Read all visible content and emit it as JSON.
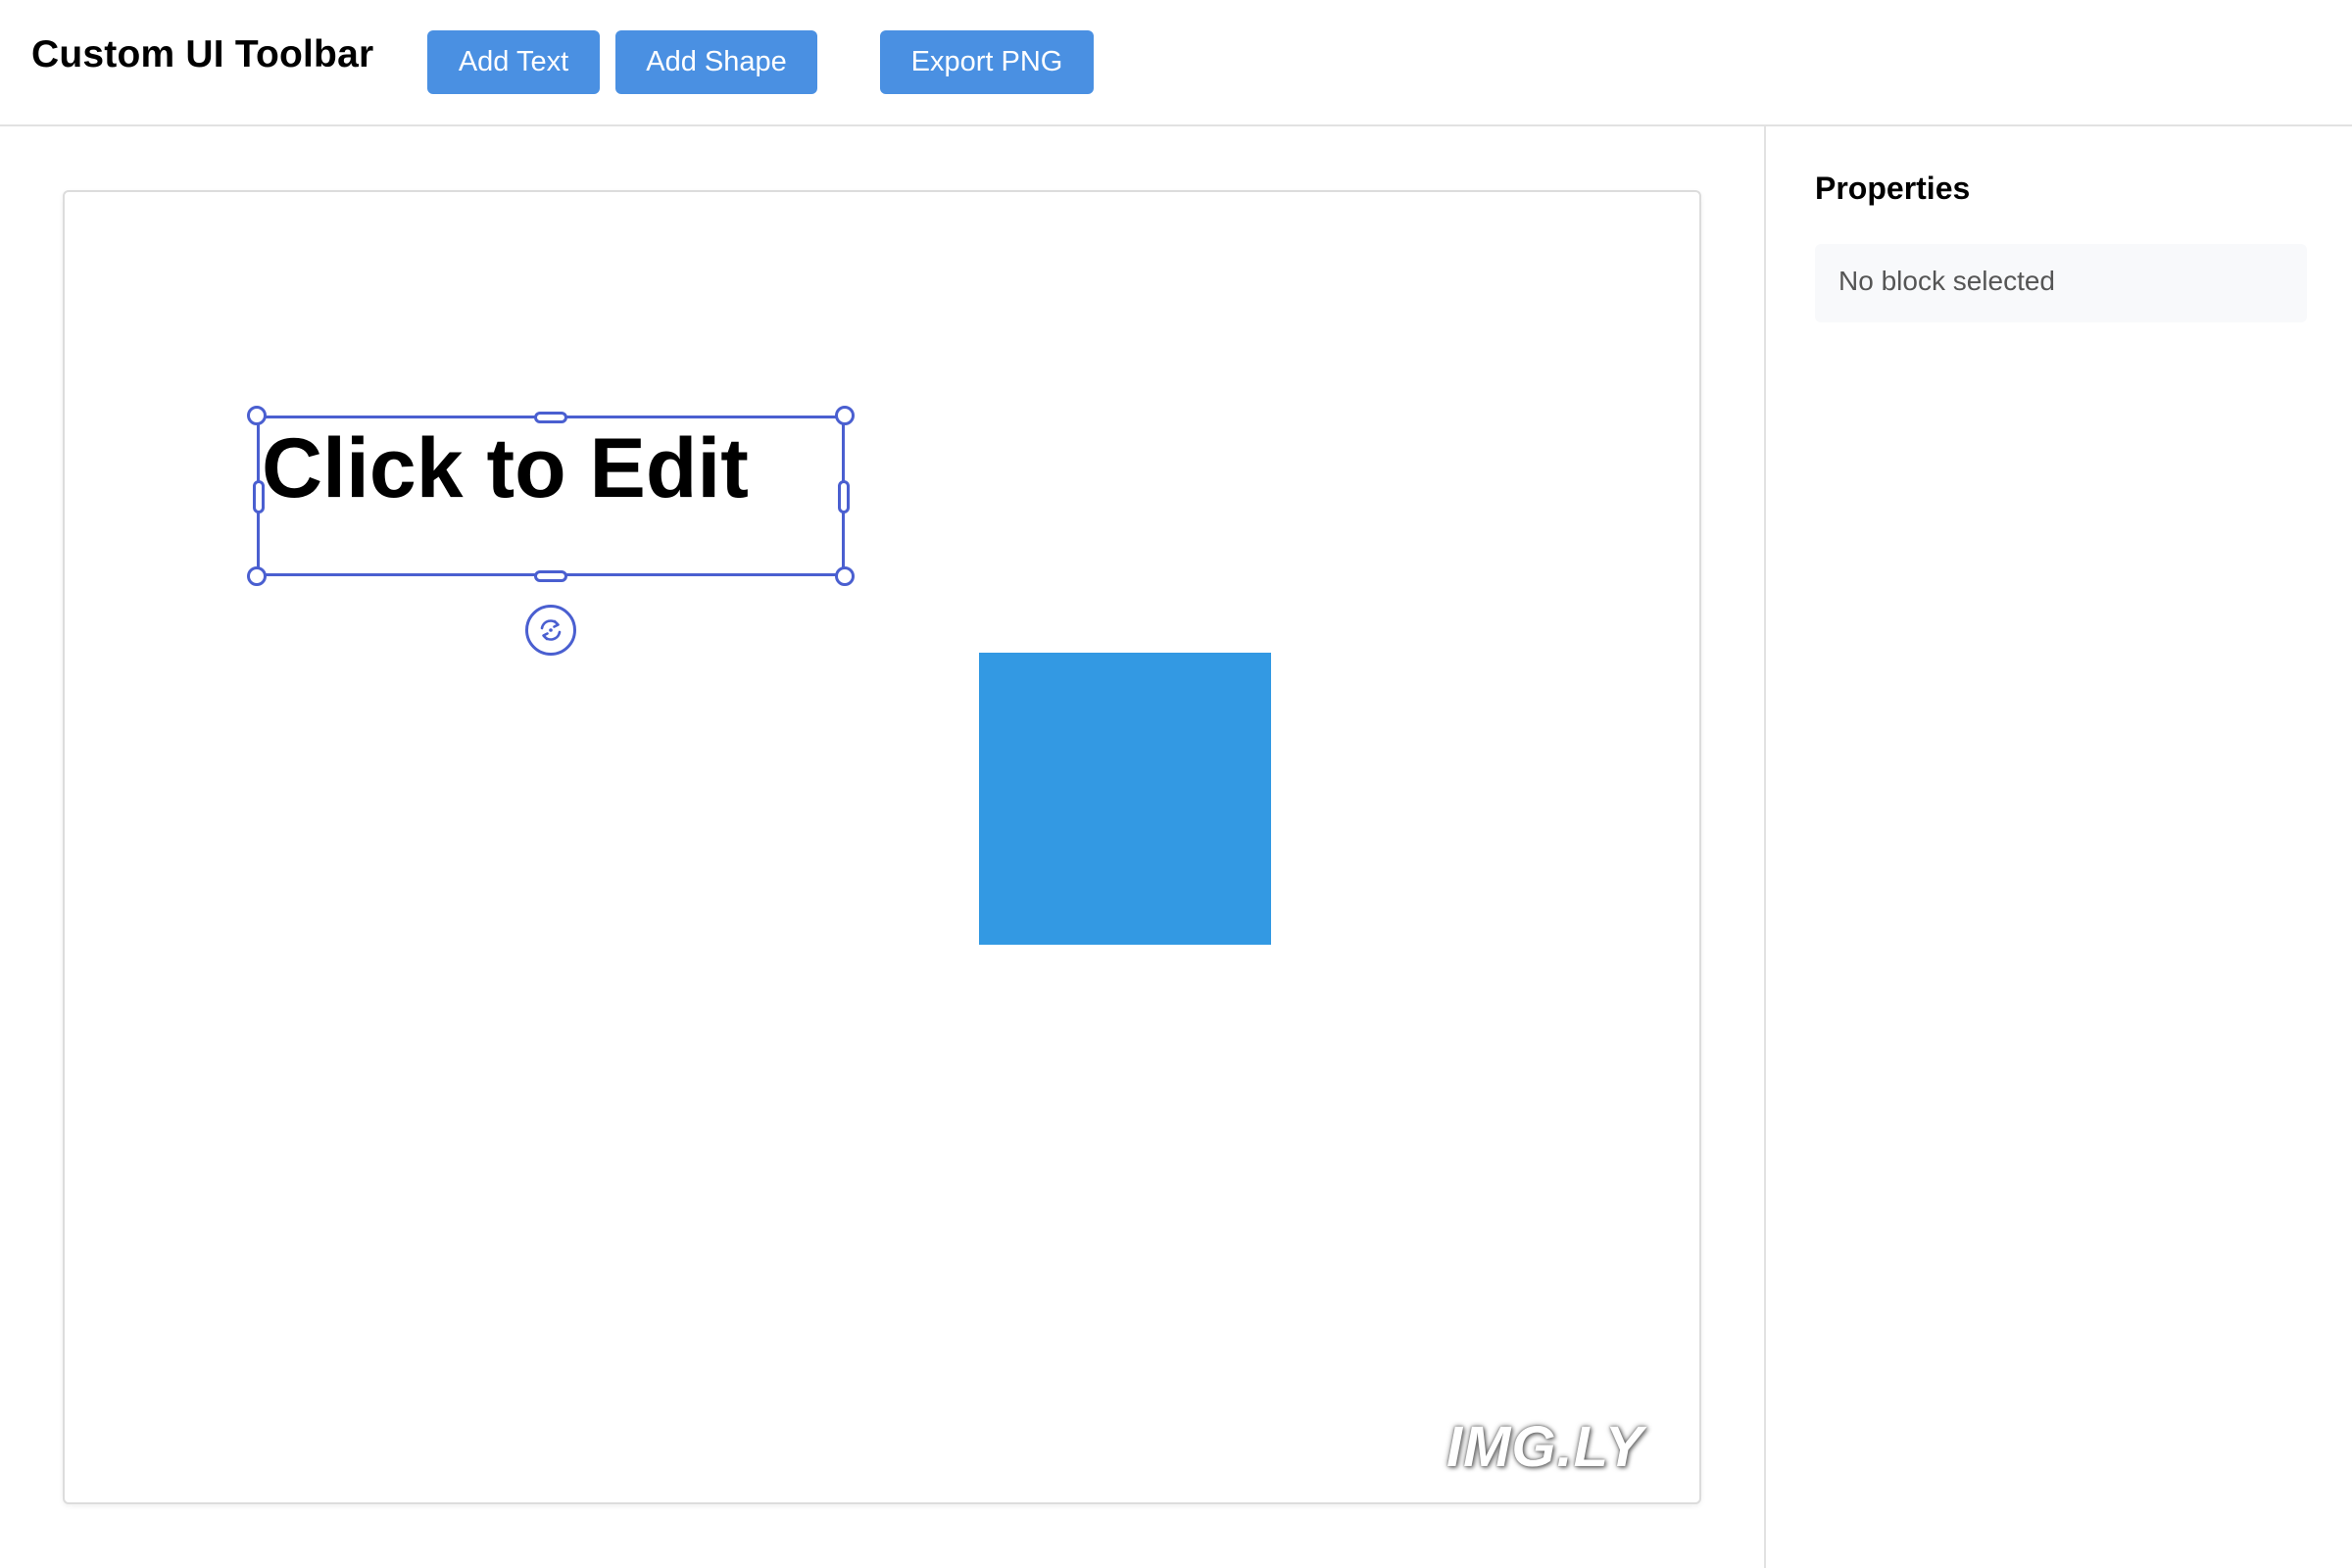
{
  "header": {
    "title": "Custom UI Toolbar",
    "buttons": {
      "add_text": "Add Text",
      "add_shape": "Add Shape",
      "export_png": "Export PNG"
    }
  },
  "canvas": {
    "text_block": {
      "text": "Click to Edit"
    },
    "shape_block": {
      "color": "#3399e3"
    },
    "watermark": "IMG.LY",
    "selection_color": "#4a5fd0"
  },
  "sidebar": {
    "title": "Properties",
    "status": "No block selected"
  },
  "icons": {
    "rotate": "rotate-icon"
  },
  "colors": {
    "button_bg": "#4a90e2",
    "button_text": "#ffffff"
  }
}
